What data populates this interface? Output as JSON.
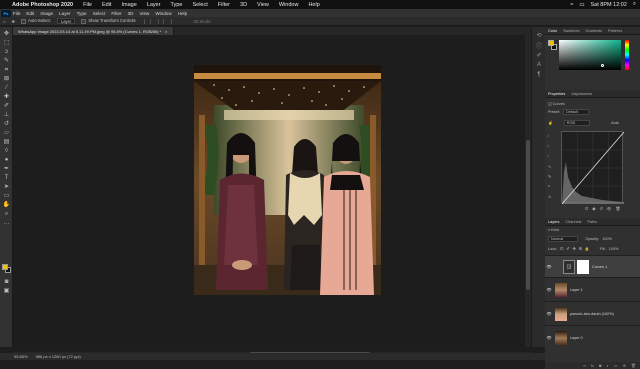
{
  "system_menu": {
    "apple": "",
    "app_name": "Adobe Photoshop 2020",
    "items": [
      "File",
      "Edit",
      "Image",
      "Layer",
      "Type",
      "Select",
      "Filter",
      "3D",
      "View",
      "Window",
      "Help"
    ],
    "clock": "Sat 8PM 12:02"
  },
  "app_menu": {
    "logo": "Ps",
    "items": [
      "File",
      "Edit",
      "Image",
      "Layer",
      "Type",
      "Select",
      "Filter",
      "3D",
      "View",
      "Window",
      "Help"
    ]
  },
  "options_bar": {
    "auto_select_label": "Auto-Select:",
    "auto_select_value": "Layer",
    "transform_label": "Show Transform Controls",
    "mode_label": "3D Mode:"
  },
  "document_tab": {
    "title": "WhatsApp Image 2022-03-14 at 5.11.49 PM.jpeg @ 95.8% (Curves 1, RGB/8#) *"
  },
  "status_bar": {
    "zoom": "95.85%",
    "doc_info": "986 px x 1280 px (72 ppi)"
  },
  "color_panel": {
    "tabs": [
      "Color",
      "Swatches",
      "Gradients",
      "Patterns"
    ],
    "fg_color": "#f2c200",
    "bg_color": "#111111"
  },
  "properties_panel": {
    "tabs": [
      "Properties",
      "Adjustments"
    ],
    "type_label": "Curves",
    "preset_label": "Preset:",
    "preset_value": "Default",
    "channel_value": "RGB",
    "auto_label": "Auto"
  },
  "layers_panel": {
    "tabs": [
      "Layers",
      "Channels",
      "Paths"
    ],
    "filter_label": "Kind",
    "blend_mode": "Normal",
    "opacity_label": "Opacity:",
    "opacity_value": "100%",
    "lock_label": "Lock:",
    "fill_label": "Fill:",
    "fill_value": "100%",
    "layers": [
      {
        "name": "Curves 1",
        "type": "adjustment"
      },
      {
        "name": "Layer 1",
        "type": "image"
      },
      {
        "name": "pseudo-lam-darsh (100%)",
        "type": "image"
      },
      {
        "name": "Layer 0",
        "type": "image"
      }
    ]
  }
}
